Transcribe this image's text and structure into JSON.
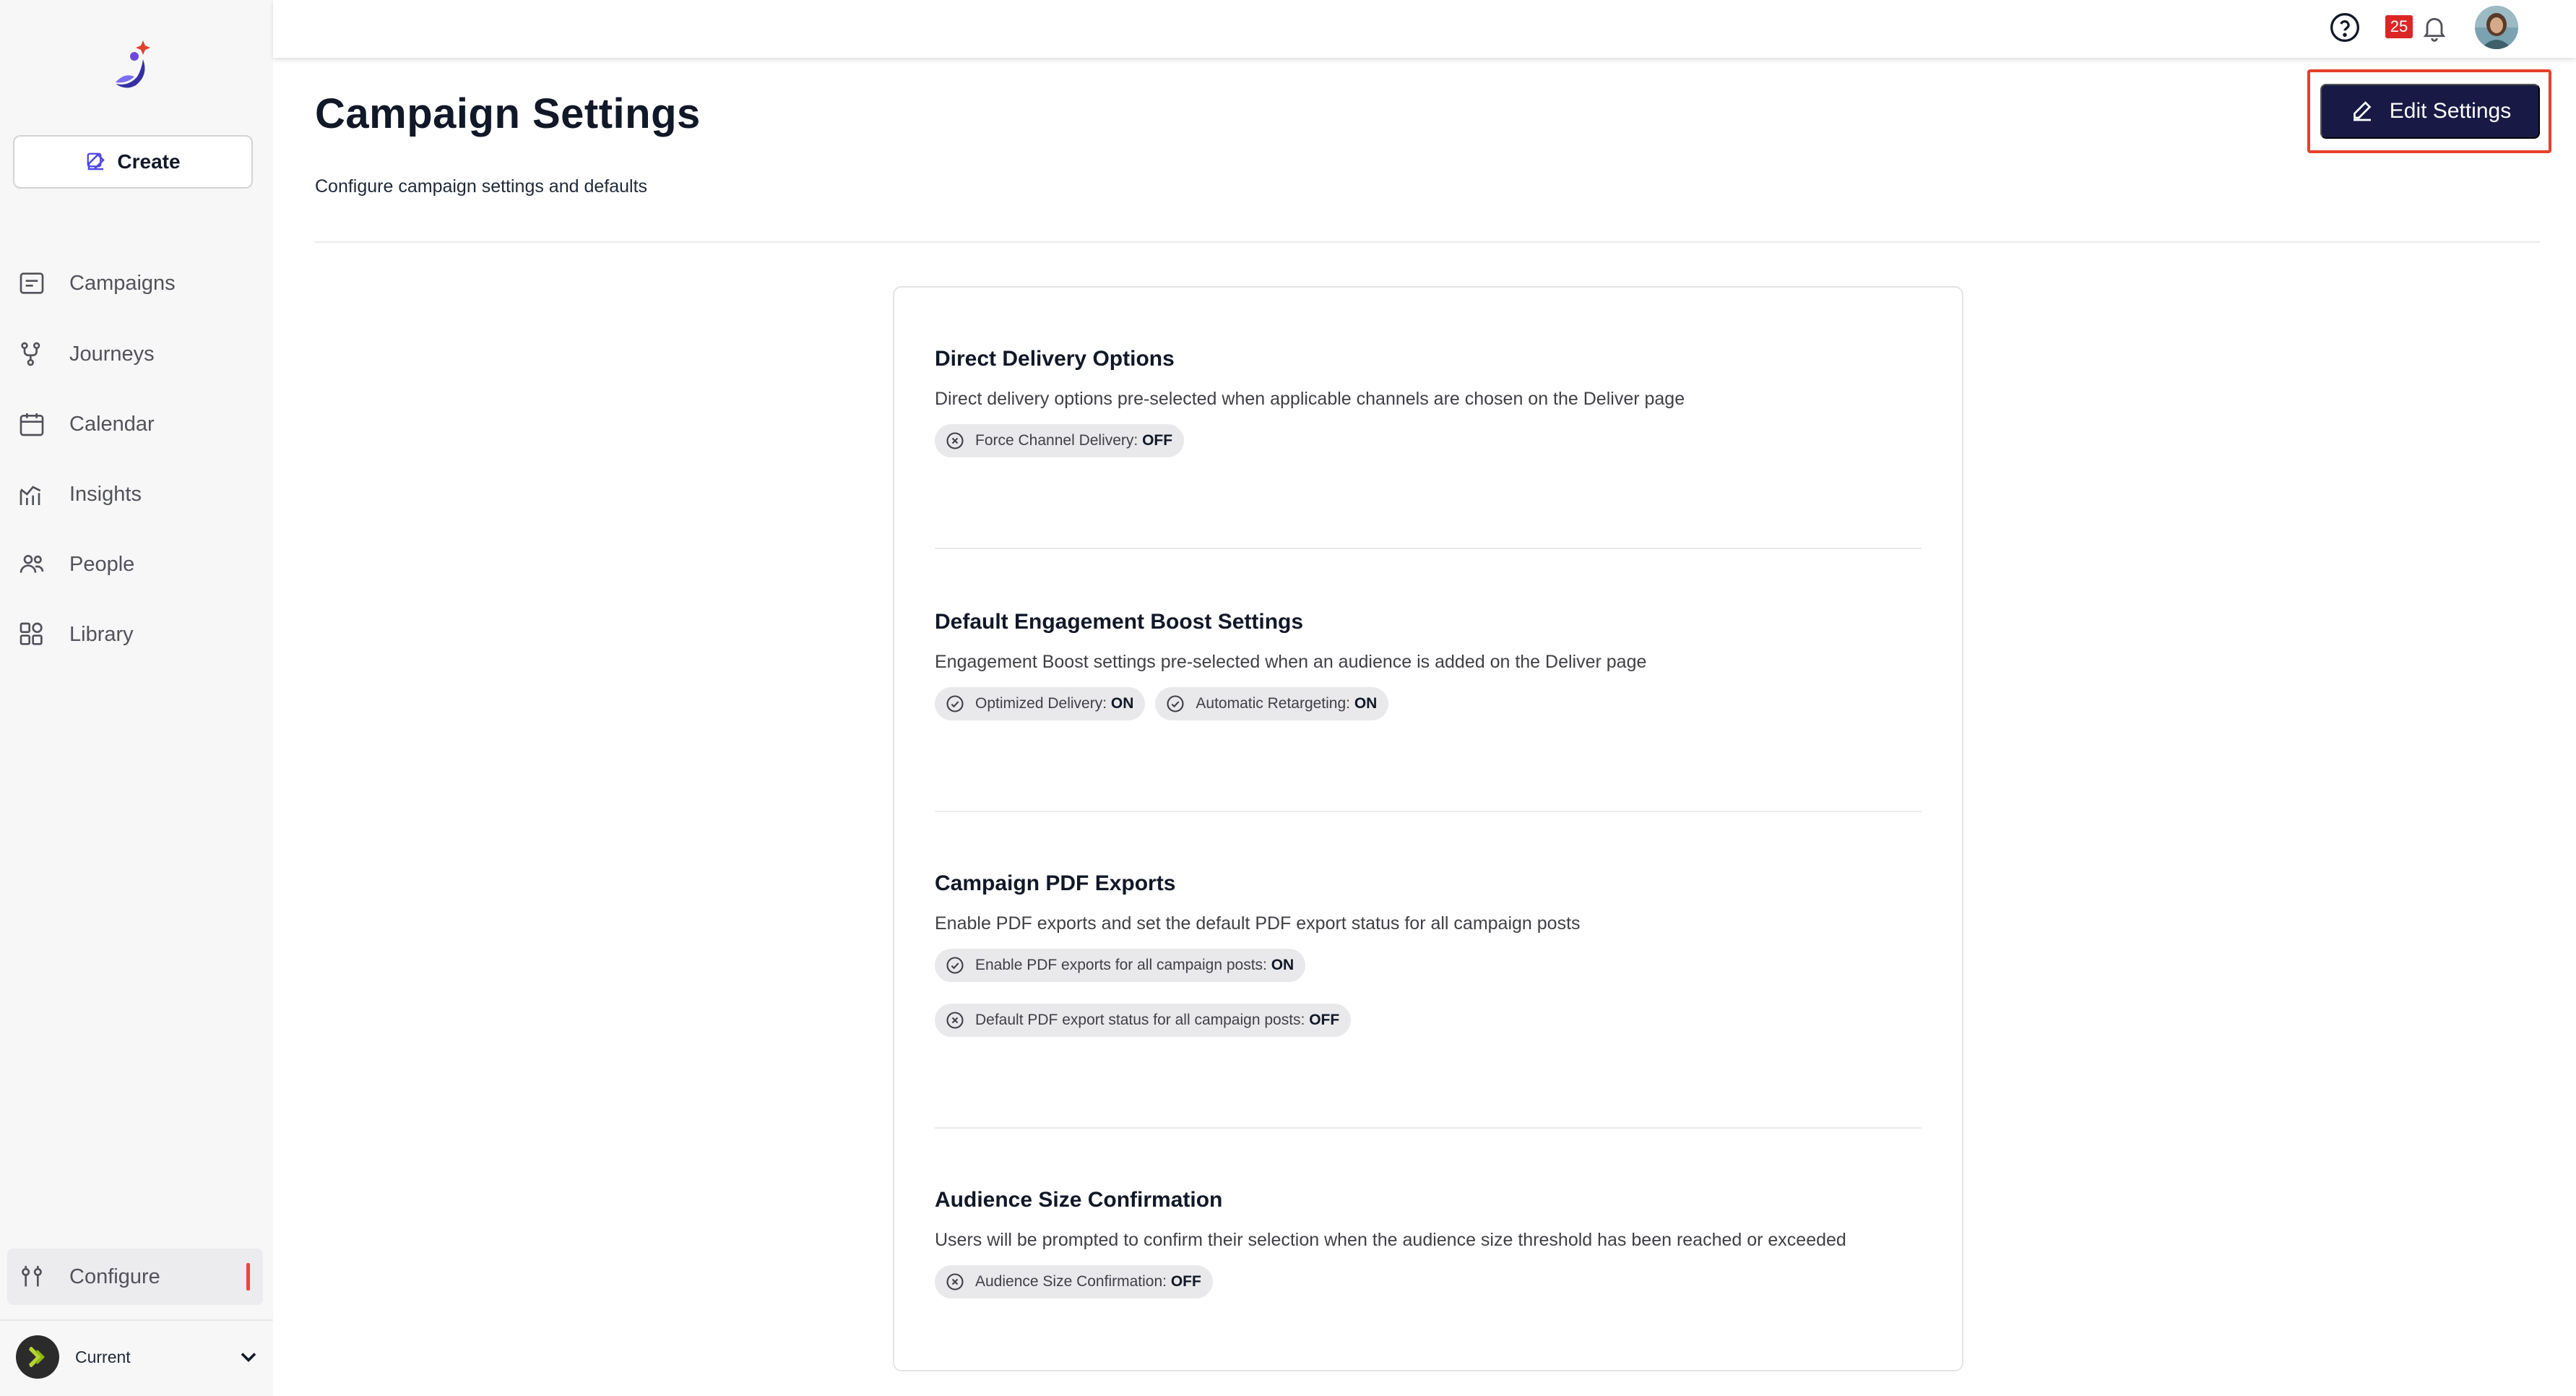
{
  "sidebar": {
    "create_label": "Create",
    "nav": [
      {
        "label": "Campaigns",
        "icon": "campaigns-icon"
      },
      {
        "label": "Journeys",
        "icon": "journeys-icon"
      },
      {
        "label": "Calendar",
        "icon": "calendar-icon"
      },
      {
        "label": "Insights",
        "icon": "insights-icon"
      },
      {
        "label": "People",
        "icon": "people-icon"
      },
      {
        "label": "Library",
        "icon": "library-icon"
      }
    ],
    "configure_label": "Configure",
    "workspace_label": "Current"
  },
  "topbar": {
    "notification_count": "25"
  },
  "page": {
    "title": "Campaign Settings",
    "subtitle": "Configure campaign settings and defaults",
    "edit_button_label": "Edit Settings"
  },
  "sections": [
    {
      "title": "Direct Delivery Options",
      "description": "Direct delivery options pre-selected when applicable channels are chosen on the Deliver page",
      "chips": [
        {
          "label": "Force Channel Delivery: ",
          "state": "OFF"
        }
      ]
    },
    {
      "title": "Default Engagement Boost Settings",
      "description": "Engagement Boost settings pre-selected when an audience is added on the Deliver page",
      "chips": [
        {
          "label": "Optimized Delivery: ",
          "state": "ON"
        },
        {
          "label": "Automatic Retargeting: ",
          "state": "ON"
        }
      ]
    },
    {
      "title": "Campaign PDF Exports",
      "description": "Enable PDF exports and set the default PDF export status for all campaign posts",
      "chips": [
        {
          "label": "Enable PDF exports for all campaign posts: ",
          "state": "ON"
        },
        {
          "label": "Default PDF export status for all campaign posts: ",
          "state": "OFF"
        }
      ]
    },
    {
      "title": "Audience Size Confirmation",
      "description": "Users will be prompted to confirm their selection when the audience size threshold has been reached or exceeded",
      "chips": [
        {
          "label": "Audience Size Confirmation: ",
          "state": "OFF"
        }
      ]
    }
  ],
  "colors": {
    "primary_button": "#181a45",
    "highlight": "#e5402b",
    "badge": "#dc2626",
    "indicator": "#ef4444"
  }
}
